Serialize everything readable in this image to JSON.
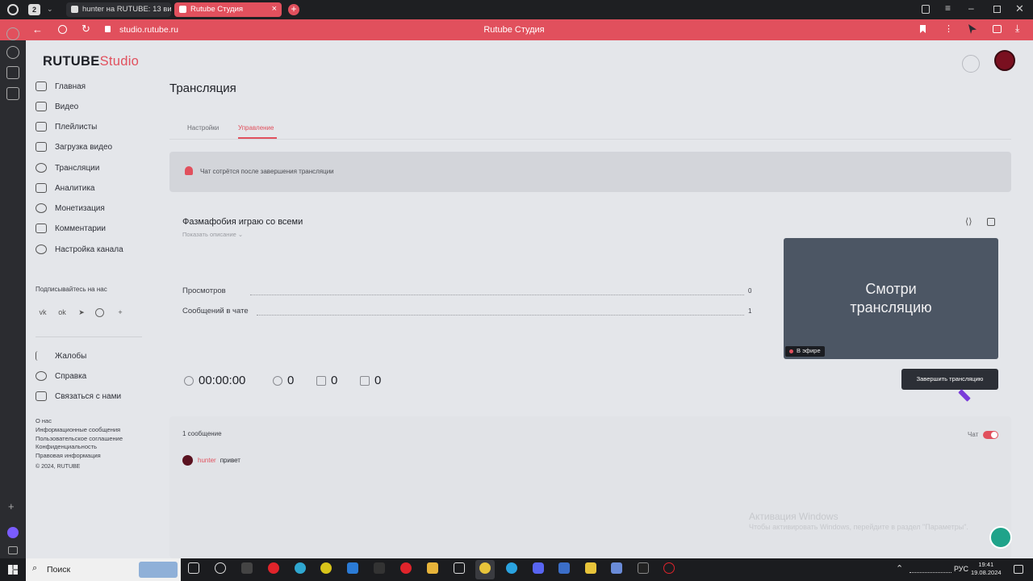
{
  "browser": {
    "tab_count": "2",
    "tabs": [
      {
        "label": "hunter на RUTUBE: 13 ви..."
      },
      {
        "label": "Rutube Студия"
      }
    ],
    "url": "studio.rutube.ru",
    "page_title": "Rutube Студия"
  },
  "brand": {
    "logo_main": "RUTUBE",
    "logo_sub": "Studio",
    "accent": "#e1505d"
  },
  "sidebar": {
    "items": [
      {
        "label": "Главная",
        "icon": "home-icon"
      },
      {
        "label": "Видео",
        "icon": "video-icon"
      },
      {
        "label": "Плейлисты",
        "icon": "playlist-icon"
      },
      {
        "label": "Загрузка видео",
        "icon": "upload-icon"
      },
      {
        "label": "Трансляции",
        "icon": "broadcast-icon"
      },
      {
        "label": "Аналитика",
        "icon": "analytics-icon"
      },
      {
        "label": "Монетизация",
        "icon": "monetization-icon"
      },
      {
        "label": "Комментарии",
        "icon": "comments-icon"
      },
      {
        "label": "Настройка канала",
        "icon": "settings-icon"
      }
    ],
    "subscribe_label": "Подписывайтесь на нас",
    "support": [
      {
        "label": "Жалобы",
        "icon": "flag-icon"
      },
      {
        "label": "Справка",
        "icon": "help-icon"
      },
      {
        "label": "Связаться с нами",
        "icon": "message-icon"
      }
    ],
    "footer_links": [
      "О нас",
      "Информационные сообщения",
      "Пользовательское соглашение",
      "Конфиденциальность",
      "Правовая информация"
    ],
    "copyright": "© 2024, RUTUBE"
  },
  "main": {
    "title": "Трансляция",
    "tabs": [
      {
        "label": "Настройки",
        "active": false
      },
      {
        "label": "Управление",
        "active": true
      }
    ],
    "notice": "Чат сотрётся после завершения трансляции",
    "stream": {
      "title": "Фазмафобия играю со всеми",
      "show_description": "Показать описание",
      "stats": [
        {
          "label": "Просмотров",
          "value": "0"
        },
        {
          "label": "Сообщений в чате",
          "value": "1"
        }
      ],
      "duration": "00:00:00",
      "viewers": "0",
      "likes": "0",
      "dislikes": "0",
      "preview_text": "Смотри трансляцию",
      "live_badge": "В эфире",
      "end_button": "Завершить трансляцию"
    },
    "chat": {
      "count_label": "1 сообщение",
      "toggle_label": "Чат",
      "toggle_on": true,
      "messages": [
        {
          "user": "hunter",
          "text": "привет"
        }
      ]
    },
    "watermark": {
      "title": "Активация Windows",
      "subtitle": "Чтобы активировать Windows, перейдите в раздел \"Параметры\"."
    }
  },
  "taskbar": {
    "search_placeholder": "Поиск",
    "lang": "РУС",
    "time": "19:41",
    "date": "19.08.2024"
  }
}
